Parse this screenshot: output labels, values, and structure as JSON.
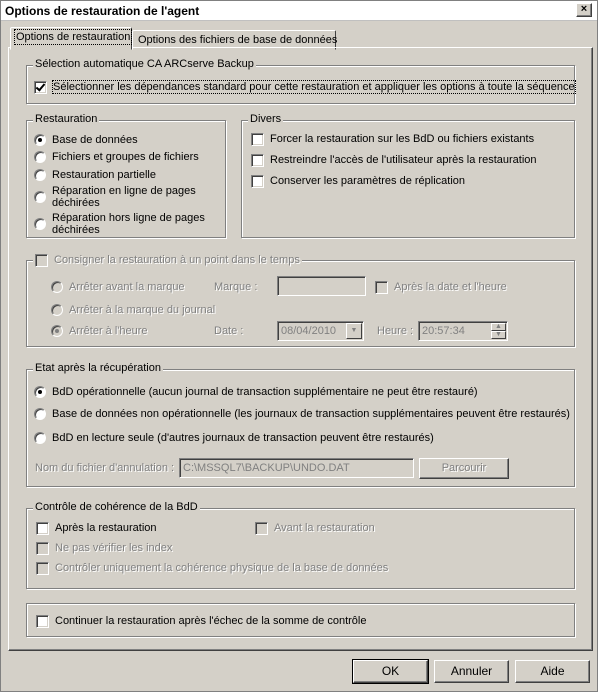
{
  "window": {
    "title": "Options de restauration de l'agent",
    "close_glyph": "×"
  },
  "tabs": [
    {
      "label": "Options de restauration",
      "active": true
    },
    {
      "label": "Options des fichiers de base de données",
      "active": false
    }
  ],
  "auto_selection": {
    "title": "Sélection automatique CA ARCserve Backup",
    "option": {
      "label": "Sélectionner les dépendances standard pour cette restauration et appliquer les options à toute la séquence",
      "checked": true
    }
  },
  "restauration": {
    "title": "Restauration",
    "options": [
      {
        "label": "Base de données",
        "checked": true
      },
      {
        "label": "Fichiers et groupes de fichiers",
        "checked": false
      },
      {
        "label": "Restauration partielle",
        "checked": false
      },
      {
        "label": "Réparation en ligne de pages déchirées",
        "checked": false
      },
      {
        "label": "Réparation hors ligne de pages déchirées",
        "checked": false
      }
    ]
  },
  "divers": {
    "title": "Divers",
    "options": [
      {
        "label": "Forcer la restauration sur les BdD ou fichiers existants",
        "checked": false
      },
      {
        "label": "Restreindre l'accès de l'utilisateur après la restauration",
        "checked": false
      },
      {
        "label": "Conserver les paramètres de réplication",
        "checked": false
      }
    ]
  },
  "point_in_time": {
    "title": "Consigner la restauration à un point dans le temps",
    "stop_before_mark": "Arrêter avant la marque",
    "stop_at_mark": "Arrêter à la marque du journal",
    "stop_at_time": "Arrêter à l'heure",
    "mark_label": "Marque :",
    "mark_value": "",
    "after_date_time": "Après la date et l'heure",
    "date_label": "Date :",
    "date_value": "08/04/2010",
    "time_label": "Heure :",
    "time_value": "20:57:34",
    "combo_glyph": "▼",
    "spin_up_glyph": "▲",
    "spin_down_glyph": "▼"
  },
  "recovery_state": {
    "title": "Etat après la récupération",
    "options": [
      {
        "label": "BdD opérationnelle (aucun journal de transaction supplémentaire ne peut être restauré)",
        "checked": true
      },
      {
        "label": "Base de données non opérationnelle (les journaux de transaction supplémentaires peuvent être restaurés)",
        "checked": false
      },
      {
        "label": "BdD en lecture seule (d'autres journaux de transaction peuvent être restaurés)",
        "checked": false
      }
    ],
    "undo_label": "Nom du fichier d'annulation :",
    "undo_value": "C:\\MSSQL7\\BACKUP\\UNDO.DAT",
    "browse_label": "Parcourir"
  },
  "consistency": {
    "title": "Contrôle de cohérence de la BdD",
    "after": "Après la restauration",
    "before": "Avant la restauration",
    "no_index": "Ne pas vérifier les index",
    "physical_only": "Contrôler uniquement la cohérence physique de la base de données"
  },
  "continue_after_checksum": {
    "label": "Continuer la restauration après l'échec de la somme de contrôle",
    "checked": false
  },
  "buttons": {
    "ok": "OK",
    "cancel": "Annuler",
    "help": "Aide"
  }
}
